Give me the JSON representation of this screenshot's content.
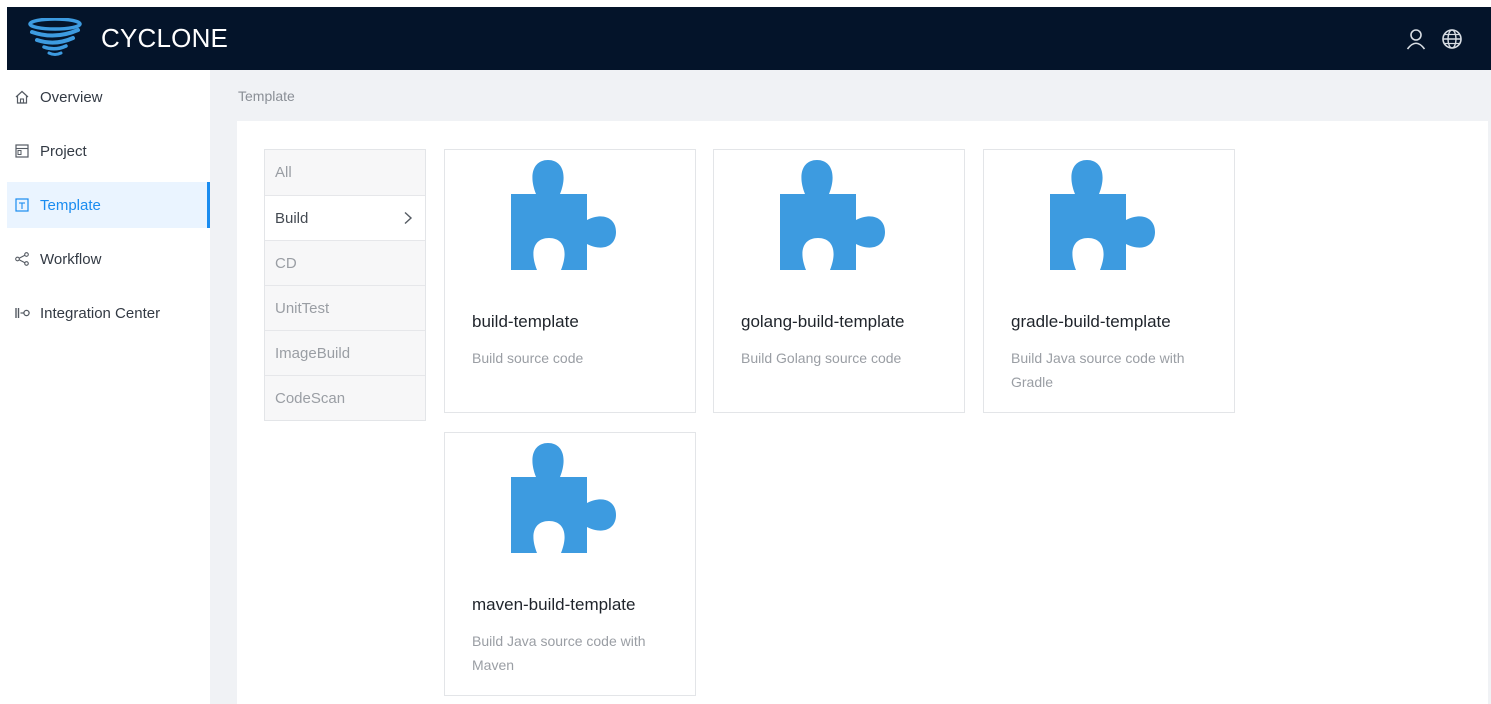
{
  "header": {
    "brand": "CYCLONE",
    "icons": [
      "user-icon",
      "globe-icon"
    ],
    "background": "#04142a"
  },
  "sidebar": {
    "items": [
      {
        "label": "Overview",
        "icon": "home-icon"
      },
      {
        "label": "Project",
        "icon": "project-icon"
      },
      {
        "label": "Template",
        "icon": "template-icon",
        "active": true
      },
      {
        "label": "Workflow",
        "icon": "share-icon"
      },
      {
        "label": "Integration Center",
        "icon": "integration-icon"
      }
    ],
    "active_color": "#1a8cf0"
  },
  "breadcrumb": "Template",
  "categories": [
    {
      "label": "All"
    },
    {
      "label": "Build",
      "active": true
    },
    {
      "label": "CD"
    },
    {
      "label": "UnitTest"
    },
    {
      "label": "ImageBuild"
    },
    {
      "label": "CodeScan"
    }
  ],
  "templates": [
    {
      "title": "build-template",
      "description": "Build source code",
      "icon": "puzzle-icon"
    },
    {
      "title": "golang-build-template",
      "description": "Build Golang source code",
      "icon": "puzzle-icon"
    },
    {
      "title": "gradle-build-template",
      "description": "Build Java source code with Gradle",
      "icon": "puzzle-icon"
    },
    {
      "title": "maven-build-template",
      "description": "Build Java source code with Maven",
      "icon": "puzzle-icon"
    }
  ],
  "puzzle_color": "#3d9be0"
}
